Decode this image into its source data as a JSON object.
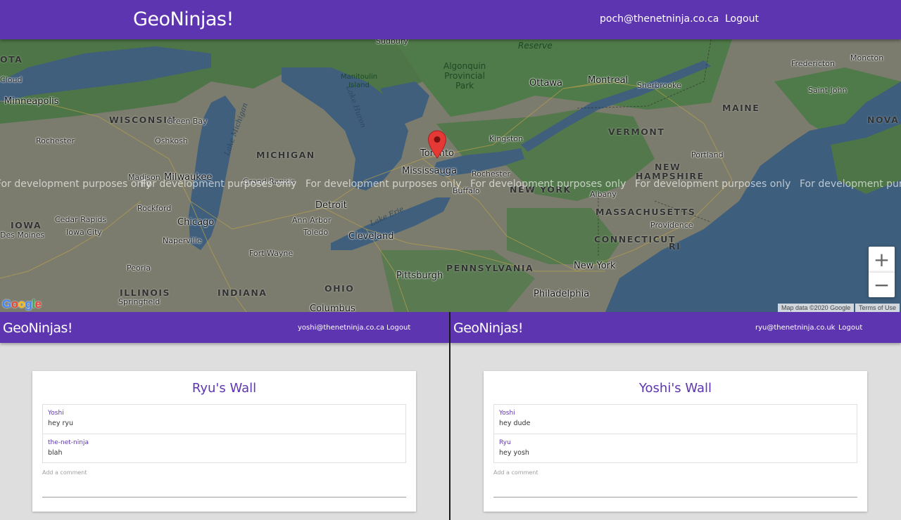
{
  "top_nav": {
    "brand": "GeoNinjas!",
    "email": "poch@thenetninja.co.ca",
    "logout": "Logout"
  },
  "map": {
    "watermark": "For development purposes only",
    "zoom_in": "+",
    "zoom_out": "−",
    "attribution": "Map data ©2020 Google",
    "terms": "Terms of Use",
    "logo": "Google",
    "labels": {
      "minneapolis": "Minneapolis",
      "wisconsin": "WISCONSIN",
      "green_bay": "Green Bay",
      "oshkosh": "Oshkosh",
      "rochester_mn": "Rochester",
      "madison": "Madison",
      "milwaukee": "Milwaukee",
      "michigan": "MICHIGAN",
      "grand_rapids": "Grand Rapids",
      "rockford": "Rockford",
      "cedar_rapids": "Cedar Rapids",
      "iowa_city": "Iowa City",
      "iowa": "IOWA",
      "des_moines": "Des Moines",
      "chicago": "Chicago",
      "naperville": "Naperville",
      "peoria": "Peoria",
      "illinois": "ILLINOIS",
      "springfield": "Springfield",
      "indiana": "INDIANA",
      "fort_wayne": "Fort Wayne",
      "detroit": "Detroit",
      "ann_arbor": "Ann Arbor",
      "toledo": "Toledo",
      "cleveland": "Cleveland",
      "ohio": "OHIO",
      "columbus": "Columbus",
      "pittsburgh": "Pittsburgh",
      "pennsylvania": "PENNSYLVANIA",
      "philadelphia": "Philadelphia",
      "new_york_city": "New York",
      "new_york_state": "NEW YORK",
      "buffalo": "Buffalo",
      "rochester_ny": "Rochester",
      "albany": "Albany",
      "toronto": "Toronto",
      "mississauga": "Mississauga",
      "kingston": "Kingston",
      "ottawa": "Ottawa",
      "montreal": "Montreal",
      "sherbrooke": "Sherbrooke",
      "vermont": "VERMONT",
      "new_hampshire_1": "NEW",
      "new_hampshire_2": "HAMPSHIRE",
      "portland": "Portland",
      "maine": "MAINE",
      "massachusetts": "MASSACHUSETTS",
      "providence": "Providence",
      "connecticut": "CONNECTICUT",
      "ri": "RI",
      "sudbury": "Sudbury",
      "algonquin": "Algonquin\nProvincial\nPark",
      "manitoulin": "Manitoulin\nIsland",
      "reserve": "Reserve",
      "fredericton": "Fredericton",
      "moncton": "Moncton",
      "saint_john": "Saint John",
      "nova": "NOVA S",
      "ota": "OTA",
      "cloud": "Cloud",
      "lake_michigan": "Lake Michigan",
      "lake_huron": "Lake Huron",
      "lake_erie": "Lake Erie"
    }
  },
  "left_pane": {
    "brand": "GeoNinjas!",
    "email": "yoshi@thenetninja.co.ca",
    "logout": "Logout",
    "wall_title": "Ryu's Wall",
    "comments": [
      {
        "author": "Yoshi",
        "text": "hey ryu"
      },
      {
        "author": "the-net-ninja",
        "text": "blah"
      }
    ],
    "input_label": "Add a comment"
  },
  "right_pane": {
    "brand": "GeoNinjas!",
    "email": "ryu@thenetninja.co.uk",
    "logout": "Logout",
    "wall_title": "Yoshi's Wall",
    "comments": [
      {
        "author": "Yoshi",
        "text": "hey dude"
      },
      {
        "author": "Ryu",
        "text": "hey yosh"
      }
    ],
    "input_label": "Add a comment"
  },
  "colors": {
    "brand_purple": "#5e35b1",
    "map_land": "#7d7d70",
    "map_water": "#3f5f7d",
    "map_forest": "#4e7a4a",
    "pin_red": "#e53935"
  }
}
